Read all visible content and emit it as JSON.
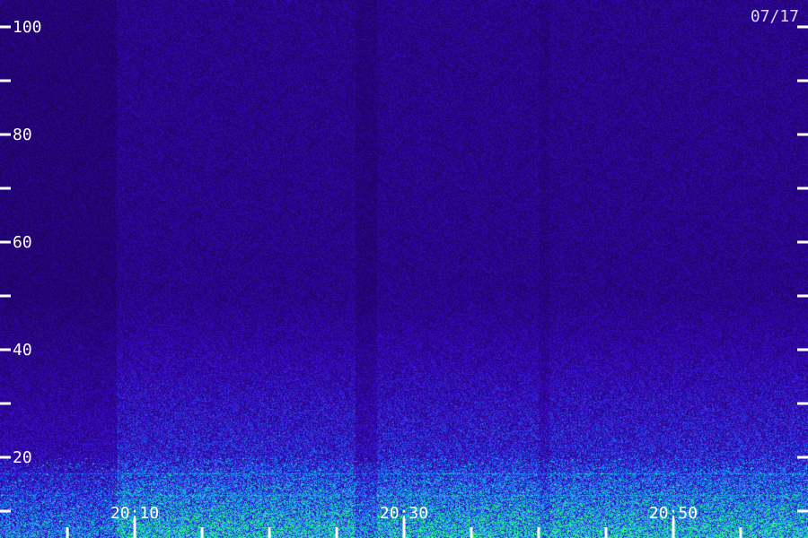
{
  "chart_data": {
    "type": "heatmap",
    "date_label": "07/17",
    "y_axis": {
      "range": [
        0,
        100
      ],
      "major_ticks": [
        20,
        40,
        60,
        80,
        100
      ],
      "major_labels": [
        "20",
        "40",
        "60",
        "80",
        "100"
      ],
      "minor_ticks": [
        10,
        30,
        50,
        70,
        90
      ]
    },
    "x_axis": {
      "range_minutes": [
        20.0,
        20.98
      ],
      "major_ticks": [
        "20:10",
        "20:30",
        "20:50"
      ],
      "tick_step_minutes": 5
    },
    "bands": [
      {
        "level": 17,
        "intensity": 0.75
      },
      {
        "level": 13,
        "intensity": 0.8
      },
      {
        "level": 7,
        "intensity": 0.85
      },
      {
        "level": 22.5,
        "intensity": 0.45
      },
      {
        "level": 26.5,
        "intensity": 0.35
      }
    ],
    "colors": {
      "background": "#2a0a78",
      "low": "#3a1ad0",
      "mid": "#1f8cff",
      "high": "#22ff88"
    }
  }
}
